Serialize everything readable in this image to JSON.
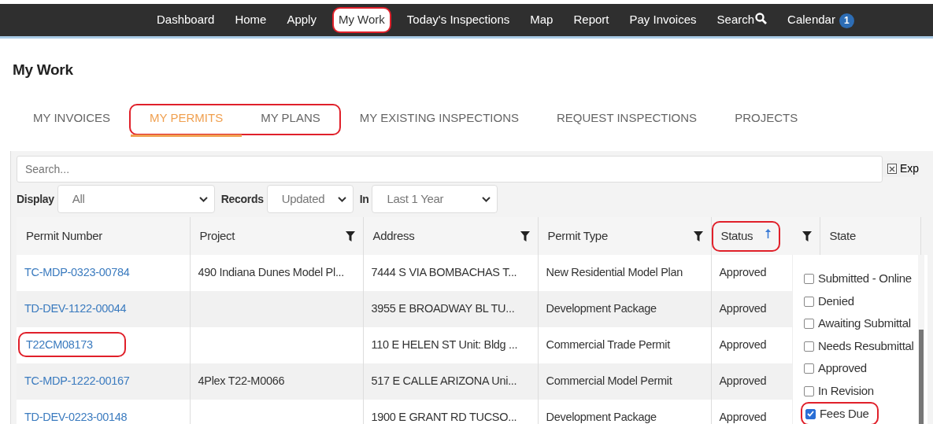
{
  "nav": {
    "items": [
      {
        "label": "Dashboard",
        "selected": false,
        "circled": false
      },
      {
        "label": "Home",
        "selected": false,
        "circled": false
      },
      {
        "label": "Apply",
        "selected": false,
        "circled": false
      },
      {
        "label": "My Work",
        "selected": true,
        "circled": true
      },
      {
        "label": "Today's Inspections",
        "selected": false,
        "circled": false
      },
      {
        "label": "Map",
        "selected": false,
        "circled": false
      },
      {
        "label": "Report",
        "selected": false,
        "circled": false
      },
      {
        "label": "Pay Invoices",
        "selected": false,
        "circled": false
      },
      {
        "label": "Search",
        "selected": false,
        "circled": false,
        "kind": "search"
      },
      {
        "label": "Calendar",
        "selected": false,
        "circled": false,
        "badge": "1"
      }
    ]
  },
  "page_title": "My Work",
  "tabs": [
    {
      "label": "MY INVOICES",
      "selected": false,
      "circled": false
    },
    {
      "label": "MY PERMITS",
      "selected": true,
      "circled": true
    },
    {
      "label": "MY PLANS",
      "selected": false,
      "circled": true
    },
    {
      "label": "MY EXISTING INSPECTIONS",
      "selected": false,
      "circled": false
    },
    {
      "label": "REQUEST INSPECTIONS",
      "selected": false,
      "circled": false
    },
    {
      "label": "PROJECTS",
      "selected": false,
      "circled": false
    }
  ],
  "search": {
    "placeholder": "Search..."
  },
  "export_label": "Exp",
  "filters": [
    {
      "label": "Display",
      "value": "All"
    },
    {
      "label": "Records",
      "value": "Updated"
    },
    {
      "label": "In",
      "value": "Last 1 Year"
    }
  ],
  "table": {
    "columns": [
      {
        "label": "Permit Number",
        "filter": false,
        "sorted": false,
        "circled": false
      },
      {
        "label": "Project",
        "filter": true,
        "sorted": false,
        "circled": false
      },
      {
        "label": "Address",
        "filter": true,
        "sorted": false,
        "circled": false
      },
      {
        "label": "Permit Type",
        "filter": true,
        "sorted": false,
        "circled": false
      },
      {
        "label": "Status",
        "filter": true,
        "sorted": true,
        "circled": true
      },
      {
        "label": "State",
        "filter": false,
        "sorted": false,
        "circled": false
      }
    ],
    "rows": [
      {
        "permit": "TC-MDP-0323-00784",
        "circled": false,
        "project": "490 Indiana Dunes Model Pl...",
        "address": "7444 S VIA BOMBACHAS T...",
        "type": "New Residential Model Plan",
        "status": "Approved"
      },
      {
        "permit": "TD-DEV-1122-00044",
        "circled": false,
        "project": "",
        "address": "3955 E BROADWAY BL TU...",
        "type": "Development Package",
        "status": "Approved"
      },
      {
        "permit": "T22CM08173",
        "circled": true,
        "project": "",
        "address": "110 E HELEN ST Unit: Bldg ...",
        "type": "Commercial Trade Permit",
        "status": "Approved"
      },
      {
        "permit": "TC-MDP-1222-00167",
        "circled": false,
        "project": "4Plex T22-M0066",
        "address": "517 E CALLE ARIZONA Uni...",
        "type": "Commercial Model Permit",
        "status": "Approved"
      },
      {
        "permit": "TD-DEV-0223-00148",
        "circled": false,
        "project": "",
        "address": "1900 E GRANT RD TUCSO...",
        "type": "Development Package",
        "status": "Approved"
      }
    ]
  },
  "state_filter": {
    "options": [
      {
        "label": "Submitted - Online",
        "checked": false,
        "circled": false
      },
      {
        "label": "Denied",
        "checked": false,
        "circled": false
      },
      {
        "label": "Awaiting Submittal",
        "checked": false,
        "circled": false
      },
      {
        "label": "Needs Resubmittal",
        "checked": false,
        "circled": false
      },
      {
        "label": "Approved",
        "checked": false,
        "circled": false
      },
      {
        "label": "In Revision",
        "checked": false,
        "circled": false
      },
      {
        "label": "Fees Due",
        "checked": true,
        "circled": true
      }
    ]
  }
}
